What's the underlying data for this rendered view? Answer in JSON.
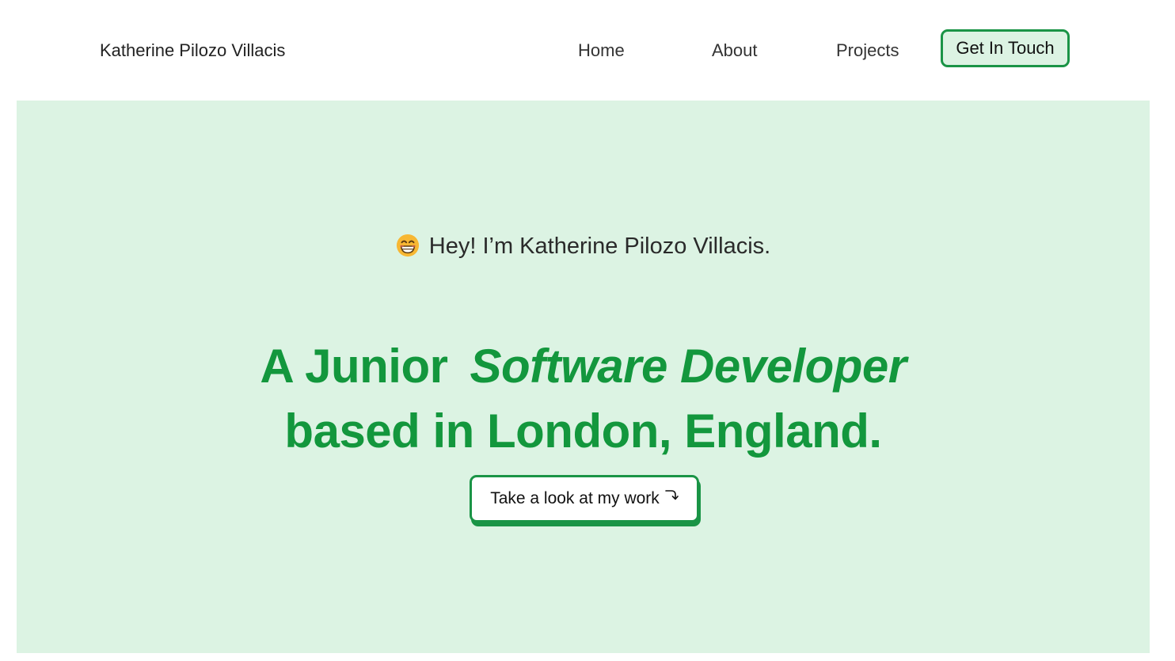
{
  "header": {
    "brand": "Katherine Pilozo Villacis",
    "nav": {
      "home": "Home",
      "about": "About",
      "projects": "Projects",
      "contact": "Get In Touch"
    }
  },
  "hero": {
    "greeting_icon": "grinning-face-icon",
    "greeting": "Hey! I’m Katherine Pilozo Villacis.",
    "headline_prefix": "A Junior",
    "headline_accent": "Software Developer",
    "headline_line2": "based in London, England.",
    "cta_label": "Take a look at my work",
    "cta_icon": "curved-arrow-down-icon"
  },
  "colors": {
    "accent_green": "#1a9446",
    "hero_background": "#dcf3e3",
    "headline_green": "#13973d"
  }
}
